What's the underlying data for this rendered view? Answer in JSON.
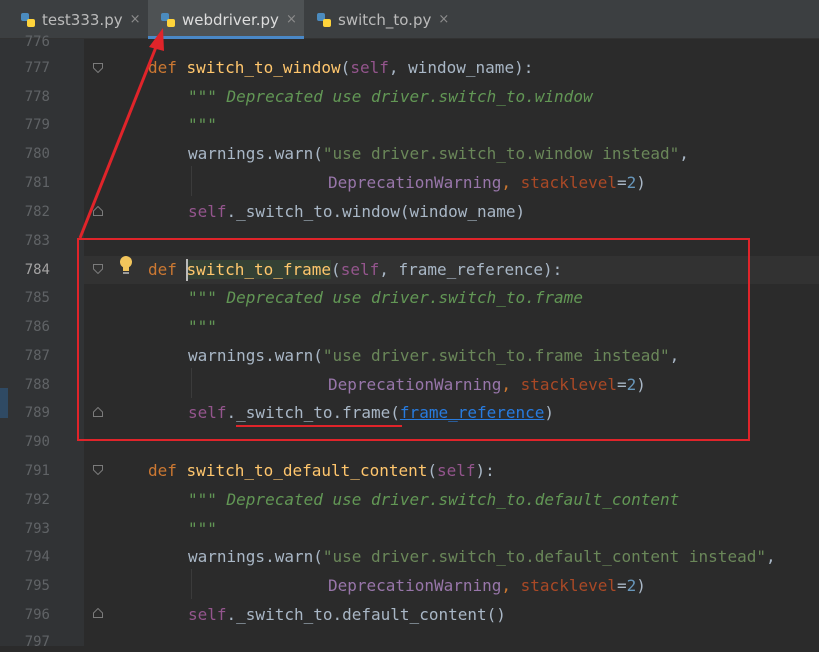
{
  "tabs": [
    {
      "label": "test333.py",
      "close": "×"
    },
    {
      "label": "webdriver.py",
      "close": "×",
      "active": true
    },
    {
      "label": "switch_to.py",
      "close": "×"
    }
  ],
  "gutter": {
    "line_numbers": [
      "776",
      "777",
      "778",
      "779",
      "780",
      "781",
      "782",
      "783",
      "784",
      "785",
      "786",
      "787",
      "788",
      "789",
      "790",
      "791",
      "792",
      "793",
      "794",
      "795",
      "796",
      "797"
    ]
  },
  "code": {
    "l777": {
      "def": "def",
      "name": "switch_to_window",
      "open": "(",
      "self": "self",
      "rest": ", window_name):"
    },
    "l778": {
      "doc": "\"\"\" Deprecated use driver.switch_to.window"
    },
    "l779": {
      "doc": "\"\"\""
    },
    "l780": {
      "pre": "warnings.warn(",
      "str": "\"use driver.switch_to.window instead\"",
      "post": ","
    },
    "l781": {
      "pre": "DeprecationWarning",
      "comma": ", ",
      "param": "stacklevel",
      "eq": "=",
      "num": "2",
      "post": ")"
    },
    "l782": {
      "self": "self",
      "rest": "._switch_to.window(window_name)"
    },
    "l784": {
      "def": "def",
      "name": "switch_to_frame",
      "open": "(",
      "self": "self",
      "rest": ", frame_reference):"
    },
    "l785": {
      "doc": "\"\"\" Deprecated use driver.switch_to.frame"
    },
    "l786": {
      "doc": "\"\"\""
    },
    "l787": {
      "pre": "warnings.warn(",
      "str": "\"use driver.switch_to.frame instead\"",
      "post": ","
    },
    "l788": {
      "pre": "DeprecationWarning",
      "comma": ", ",
      "param": "stacklevel",
      "eq": "=",
      "num": "2",
      "post": ")"
    },
    "l789": {
      "self": "self",
      "rest": "._switch_to.frame(",
      "link": "frame_reference",
      "close": ")"
    },
    "l791": {
      "def": "def",
      "name": "switch_to_default_content",
      "open": "(",
      "self": "self",
      "rest": "):"
    },
    "l792": {
      "doc": "\"\"\" Deprecated use driver.switch_to.default_content"
    },
    "l793": {
      "doc": "\"\"\""
    },
    "l794": {
      "pre": "warnings.warn(",
      "str": "\"use driver.switch_to.default_content instead\"",
      "post": ","
    },
    "l795": {
      "pre": "DeprecationWarning",
      "comma": ", ",
      "param": "stacklevel",
      "eq": "=",
      "num": "2",
      "post": ")"
    },
    "l796": {
      "self": "self",
      "rest": "._switch_to.default_content()"
    }
  },
  "colors": {
    "annotation": "#e0242a",
    "active_tab_underline": "#4a88c7",
    "keyword": "#cc7832",
    "function": "#ffc66d",
    "self": "#94558d",
    "string": "#6a8759",
    "docstring": "#629755",
    "number": "#6897bb",
    "param": "#aa4926",
    "link": "#287bde"
  },
  "icons": [
    "python-file-icon",
    "close-icon",
    "fold-icon",
    "intention-bulb-icon"
  ]
}
